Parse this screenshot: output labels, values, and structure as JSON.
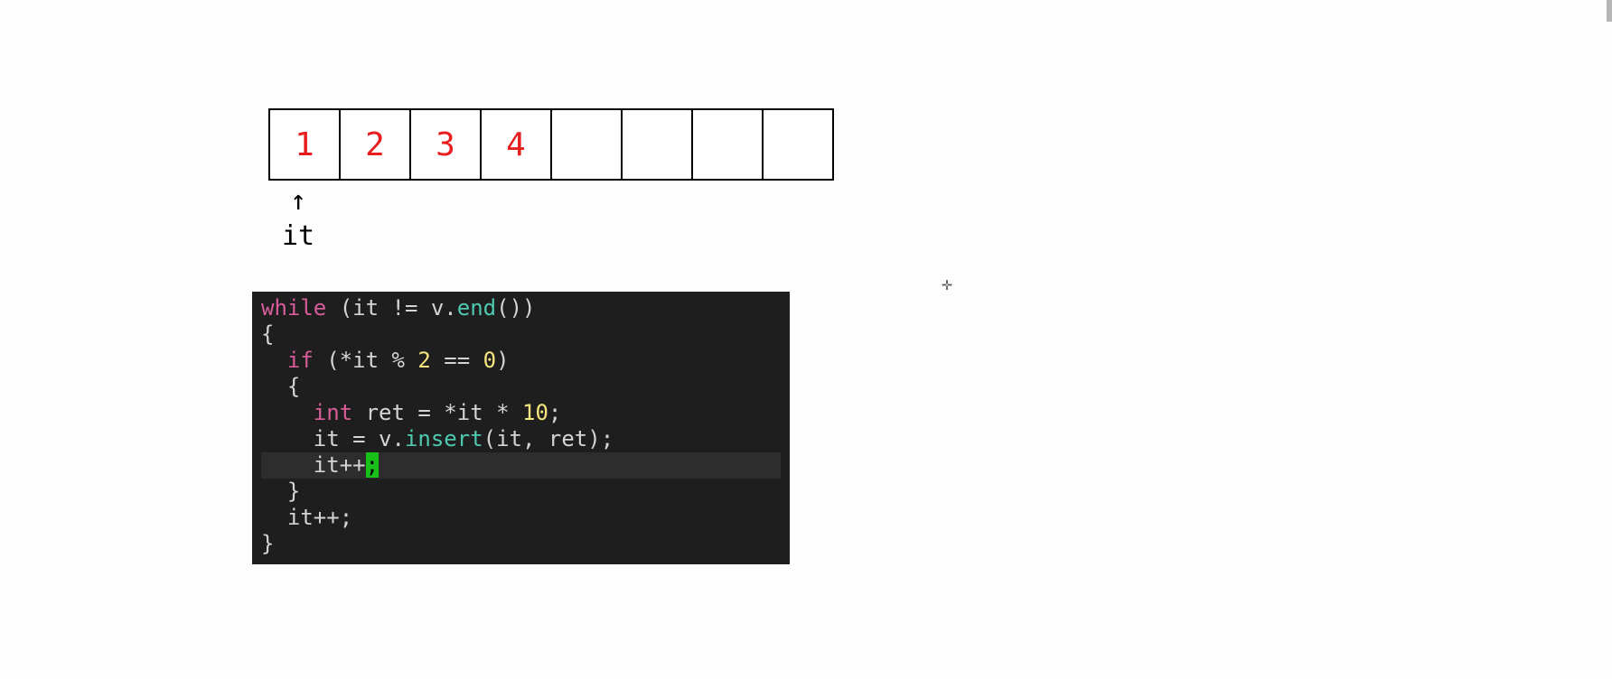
{
  "array": {
    "cells": [
      "1",
      "2",
      "3",
      "4",
      "",
      "",
      "",
      ""
    ]
  },
  "pointer": {
    "label": "it",
    "target_index": 0
  },
  "code": {
    "line0": {
      "while": "while",
      "sp0": " (",
      "id0": "it",
      "mid": " != v.",
      "end": "end",
      "tail": "())"
    },
    "line1": {
      "text": "{"
    },
    "line2": {
      "ind": "  ",
      "if": "if",
      "pre": " (*it % ",
      "two": "2",
      "mid": " == ",
      "zero": "0",
      "post": ")"
    },
    "line3": {
      "ind": "  ",
      "text": "{"
    },
    "line4": {
      "ind": "    ",
      "int": "int",
      "mid": " ret = *it * ",
      "ten": "10",
      "post": ";"
    },
    "line5": {
      "ind": "    ",
      "pre": "it = v.",
      "insert": "insert",
      "post": "(it, ret);"
    },
    "line6": {
      "ind": "    ",
      "body": "it++",
      "cursor": ";"
    },
    "line7": {
      "ind": "  ",
      "text": "}"
    },
    "line8": {
      "ind": "  ",
      "text": "it++;"
    },
    "line9": {
      "text": "}"
    }
  },
  "crosshair_glyph": "✛"
}
